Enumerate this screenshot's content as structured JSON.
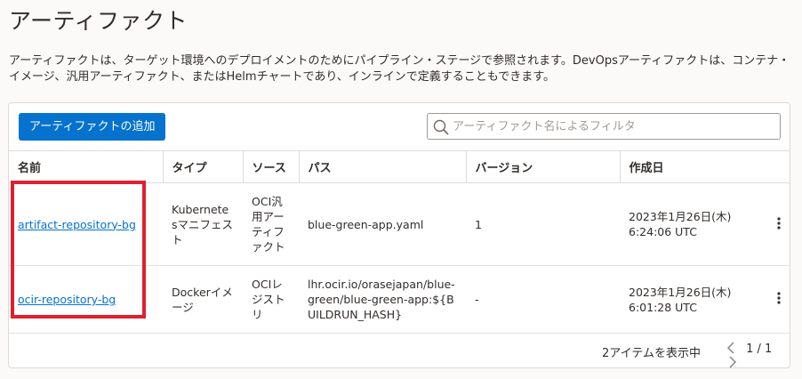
{
  "page": {
    "title": "アーティファクト",
    "description": "アーティファクトは、ターゲット環境へのデプロイメントのためにパイプライン・ステージで参照されます。DevOpsアーティファクトは、コンテナ・イメージ、汎用アーティファクト、またはHelmチャートであり、インラインで定義することもできます。"
  },
  "toolbar": {
    "add_label": "アーティファクトの追加",
    "filter_placeholder": "アーティファクト名によるフィルタ"
  },
  "table": {
    "columns": [
      "名前",
      "タイプ",
      "ソース",
      "パス",
      "バージョン",
      "作成日"
    ],
    "rows": [
      {
        "name": "artifact-repository-bg",
        "type": "Kubernetesマニフェスト",
        "source": "OCI汎用アーティファクト",
        "path": "blue-green-app.yaml",
        "version": "1",
        "created": "2023年1月26日(木) 6:24:06 UTC"
      },
      {
        "name": "ocir-repository-bg",
        "type": "Dockerイメージ",
        "source": "OCIレジストリ",
        "path": "lhr.ocir.io/orasejapan/blue-green/blue-green-app:${BUILDRUN_HASH}",
        "version": "-",
        "created": "2023年1月26日(木) 6:01:28 UTC"
      }
    ]
  },
  "footer": {
    "count_text": "2アイテムを表示中",
    "page_text": "1 / 1"
  },
  "icons": {
    "search": "search-icon",
    "kebab": "kebab-menu-icon",
    "prev": "chevron-left-icon",
    "next": "chevron-right-icon"
  },
  "colors": {
    "primary": "#0572ce",
    "highlight": "#e0202e"
  }
}
